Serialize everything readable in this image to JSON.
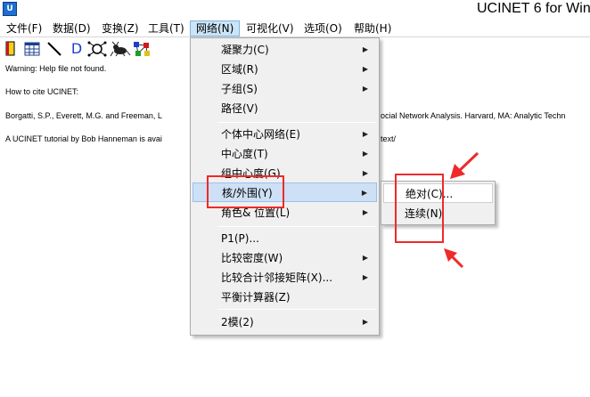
{
  "window": {
    "title": "UCINET 6 for Win",
    "app_icon": "ucinet-app-icon"
  },
  "menubar": [
    {
      "label": "文件(F)"
    },
    {
      "label": "数据(D)"
    },
    {
      "label": "变换(Z)"
    },
    {
      "label": "工具(T)"
    },
    {
      "label": "网络(N)"
    },
    {
      "label": "可视化(V)"
    },
    {
      "label": "选项(O)"
    },
    {
      "label": "帮助(H)"
    }
  ],
  "toolbar": {
    "icons": [
      "open-file-icon",
      "matrix-editor-icon",
      "draw-line-icon",
      "d-label-icon",
      "netdraw-icon",
      "mage-3d-icon",
      "graph-network-icon"
    ],
    "d_label": "D"
  },
  "log": [
    "Warning: Help file not found.",
    "How to cite UCINET:",
    "Borgatti, S.P., Everett, M.G. and Freeman, L",
    "ocial Network Analysis. Harvard, MA: Analytic Techn",
    "A UCINET tutorial by Bob Hanneman is avai",
    "text/"
  ],
  "network_menu": {
    "items": [
      {
        "label": "凝聚力(C)",
        "has_submenu": true
      },
      {
        "label": "区域(R)",
        "has_submenu": true
      },
      {
        "label": "子组(S)",
        "has_submenu": true
      },
      {
        "label": "路径(V)",
        "has_submenu": false
      },
      {
        "label": "个体中心网络(E)",
        "has_submenu": true
      },
      {
        "label": "中心度(T)",
        "has_submenu": true
      },
      {
        "label": "组中心度(G)",
        "has_submenu": true
      },
      {
        "label": "核/外围(Y)",
        "has_submenu": true
      },
      {
        "label": "角色& 位置(L)",
        "has_submenu": true
      },
      {
        "label": "P1(P)...",
        "has_submenu": false
      },
      {
        "label": "比较密度(W)",
        "has_submenu": true
      },
      {
        "label": "比较合计邻接矩阵(X)...",
        "has_submenu": true
      },
      {
        "label": "平衡计算器(Z)",
        "has_submenu": false
      },
      {
        "label": "2模(2)",
        "has_submenu": true
      }
    ]
  },
  "core_periphery_submenu": {
    "items": [
      {
        "label": "绝对(C)..."
      },
      {
        "label": "连续(N)"
      }
    ]
  },
  "colors": {
    "annotation_red": "#ee2a2a",
    "menu_highlight": "#cde0f5"
  }
}
